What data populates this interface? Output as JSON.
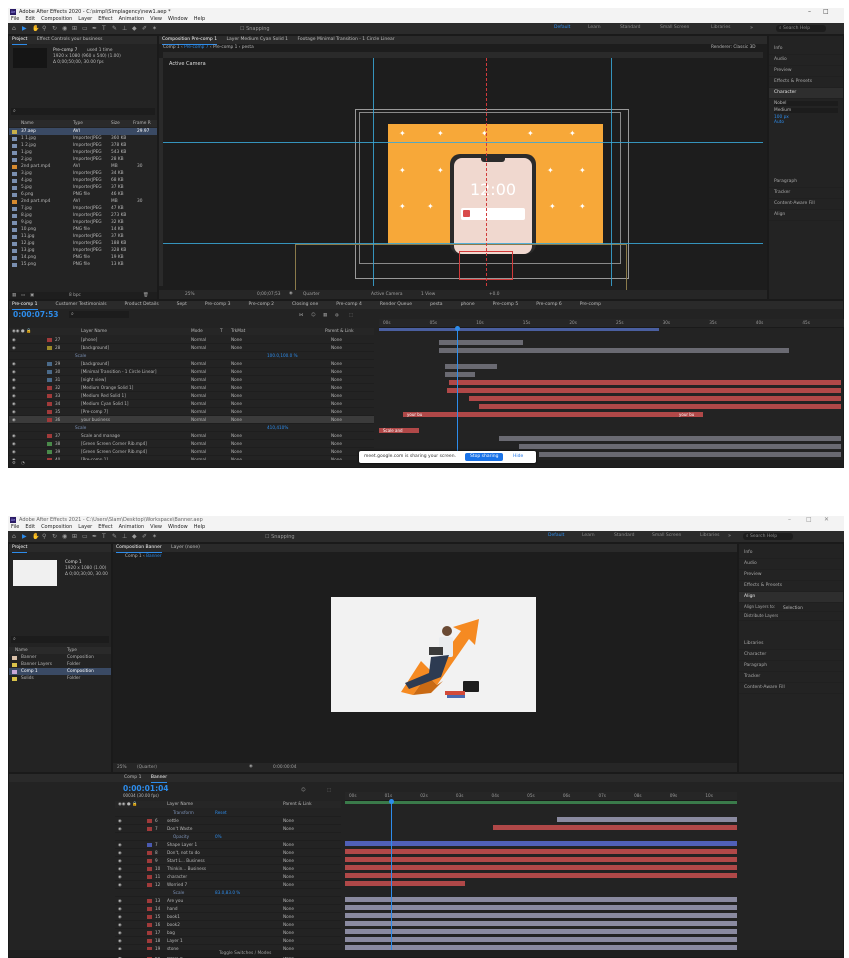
{
  "top": {
    "title": "Adobe After Effects 2020 - C:\\simpl\\Simplagency\\new1.aep *",
    "menu": [
      "File",
      "Edit",
      "Composition",
      "Layer",
      "Effect",
      "Animation",
      "View",
      "Window",
      "Help"
    ],
    "snapping": "Snapping",
    "workspaces": [
      "Default",
      "Learn",
      "Standard",
      "Small Screen",
      "Libraries"
    ],
    "search_placeholder": "Search Help",
    "project_tab": "Project",
    "effect_tab": "Effect Controls your business",
    "precomp_name": "Pre-comp 7",
    "precomp_used": "used 1 time",
    "precomp_info1": "1920 x 1080 (960 x 540) (1.00)",
    "precomp_info2": "Δ 0;00;50;00, 30.00 fps",
    "comp_tabs": [
      "Composition Pre-comp 1",
      "Layer Medium Cyan Solid 1",
      "Footage Minimal Transition - 1 Circle Linear"
    ],
    "viewer_tabs": [
      "Comp 1",
      "Pre-comp 7",
      "Pre-comp 1",
      "pesta"
    ],
    "renderer": "Renderer: Classic 3D",
    "active_camera": "Active Camera",
    "phone_time": "12:00",
    "viewer_bottom": {
      "zoom": "25%",
      "time": "0;00;07;53",
      "res": "Quarter",
      "camera": "Active Camera",
      "view": "1 View",
      "plus": "+0.0"
    },
    "project_columns": [
      "Name",
      "Type",
      "Size",
      "Frame R"
    ],
    "files": [
      {
        "name": "37.aep",
        "type": "AVI",
        "size": "",
        "fr": "29.97",
        "color": "#c8b04a"
      },
      {
        "name": "1 1.jpg",
        "type": "ImporterJPEG",
        "size": "360 KB",
        "fr": "",
        "color": "#7a8fb0"
      },
      {
        "name": "1 2.jpg",
        "type": "ImporterJPEG",
        "size": "378 KB",
        "fr": "",
        "color": "#7a8fb0"
      },
      {
        "name": "1.jpg",
        "type": "ImporterJPEG",
        "size": "543 KB",
        "fr": "",
        "color": "#7a8fb0"
      },
      {
        "name": "2.jpg",
        "type": "ImporterJPEG",
        "size": "28 KB",
        "fr": "",
        "color": "#7a8fb0"
      },
      {
        "name": "2nd part.mp4",
        "type": "AVI",
        "size": "MB",
        "fr": "30",
        "color": "#d68a2f"
      },
      {
        "name": "3.jpg",
        "type": "ImporterJPEG",
        "size": "34 KB",
        "fr": "",
        "color": "#7a8fb0"
      },
      {
        "name": "4.jpg",
        "type": "ImporterJPEG",
        "size": "68 KB",
        "fr": "",
        "color": "#7a8fb0"
      },
      {
        "name": "5.jpg",
        "type": "ImporterJPEG",
        "size": "37 KB",
        "fr": "",
        "color": "#7a8fb0"
      },
      {
        "name": "6.png",
        "type": "PNG file",
        "size": "46 KB",
        "fr": "",
        "color": "#7a8fb0"
      },
      {
        "name": "2nd part.mp4",
        "type": "AVI",
        "size": "MB",
        "fr": "30",
        "color": "#d68a2f"
      },
      {
        "name": "7.jpg",
        "type": "ImporterJPEG",
        "size": "47 KB",
        "fr": "",
        "color": "#7a8fb0"
      },
      {
        "name": "8.jpg",
        "type": "ImporterJPEG",
        "size": "273 KB",
        "fr": "",
        "color": "#7a8fb0"
      },
      {
        "name": "9.jpg",
        "type": "ImporterJPEG",
        "size": "32 KB",
        "fr": "",
        "color": "#7a8fb0"
      },
      {
        "name": "10.png",
        "type": "PNG file",
        "size": "14 KB",
        "fr": "",
        "color": "#7a8fb0"
      },
      {
        "name": "11.jpg",
        "type": "ImporterJPEG",
        "size": "37 KB",
        "fr": "",
        "color": "#7a8fb0"
      },
      {
        "name": "12.jpg",
        "type": "ImporterJPEG",
        "size": "188 KB",
        "fr": "",
        "color": "#7a8fb0"
      },
      {
        "name": "13.jpg",
        "type": "ImporterJPEG",
        "size": "328 KB",
        "fr": "",
        "color": "#7a8fb0"
      },
      {
        "name": "14.png",
        "type": "PNG file",
        "size": "19 KB",
        "fr": "",
        "color": "#7a8fb0"
      },
      {
        "name": "15.png",
        "type": "PNG file",
        "size": "13 KB",
        "fr": "",
        "color": "#7a8fb0"
      }
    ],
    "project_bpc": "8 bpc",
    "right_items": [
      "Info",
      "Audio",
      "Preview",
      "Effects & Presets",
      "Character",
      "Paragraph",
      "Tracker",
      "Content-Aware Fill",
      "Align"
    ],
    "char_font": "Nobel",
    "char_style": "Medium",
    "char_size": "100 px",
    "char_leading": "Auto",
    "timeline_tabs": [
      "Pre-comp 1",
      "Customer Testimonials",
      "Product Details",
      "Sept",
      "Pre-comp 3",
      "Pre-comp 2",
      "Closing one",
      "Pre-comp 4",
      "Render Queue",
      "pesta",
      "phone",
      "Pre-comp 5",
      "Pre-comp 6",
      "Pre-comp"
    ],
    "timecode": "0:00:07:53",
    "layer_columns": [
      "Layer Name",
      "Mode",
      "T",
      "TrkMat",
      "Parent & Link"
    ],
    "ruler_ticks": [
      "00s",
      "05s",
      "10s",
      "15s",
      "20s",
      "25s",
      "30s",
      "35s",
      "40s",
      "45s"
    ],
    "layers": [
      {
        "num": "27",
        "name": "[phone]",
        "mode": "Normal",
        "trk": "None",
        "parent": "None",
        "color": "#a03a3a",
        "sub": false
      },
      {
        "num": "28",
        "name": "[background]",
        "mode": "Normal",
        "trk": "None",
        "parent": "None",
        "color": "#9c8a2a",
        "sub": false
      },
      {
        "num": "",
        "name": "Scale",
        "mode": "",
        "trk": "",
        "parent": "100.0,100.0 %",
        "color": "",
        "sub": true
      },
      {
        "num": "29",
        "name": "[background]",
        "mode": "Normal",
        "trk": "None",
        "parent": "None",
        "color": "#4a6a8a",
        "sub": false
      },
      {
        "num": "30",
        "name": "[Minimal Transition - 1 Circle Linear]",
        "mode": "Normal",
        "trk": "None",
        "parent": "None",
        "color": "#4a6a8a",
        "sub": false
      },
      {
        "num": "31",
        "name": "[night view]",
        "mode": "Normal",
        "trk": "None",
        "parent": "None",
        "color": "#4a6a8a",
        "sub": false
      },
      {
        "num": "32",
        "name": "[Medium Orange Solid 1]",
        "mode": "Normal",
        "trk": "None",
        "parent": "None",
        "color": "#a03a3a",
        "sub": false
      },
      {
        "num": "33",
        "name": "[Medium Red Solid 1]",
        "mode": "Normal",
        "trk": "None",
        "parent": "None",
        "color": "#a03a3a",
        "sub": false
      },
      {
        "num": "34",
        "name": "[Medium Cyan Solid 1]",
        "mode": "Normal",
        "trk": "None",
        "parent": "None",
        "color": "#a03a3a",
        "sub": false
      },
      {
        "num": "35",
        "name": "[Pre-comp 7]",
        "mode": "Normal",
        "trk": "None",
        "parent": "None",
        "color": "#a03a3a",
        "sub": false
      },
      {
        "num": "36",
        "name": "your business",
        "mode": "Normal",
        "trk": "None",
        "parent": "None",
        "color": "#a03a3a",
        "sub": false
      },
      {
        "num": "",
        "name": "Scale",
        "mode": "",
        "trk": "",
        "parent": "410,410%",
        "color": "",
        "sub": true
      },
      {
        "num": "37",
        "name": "Scale and manage",
        "mode": "Normal",
        "trk": "None",
        "parent": "None",
        "color": "#a03a3a",
        "sub": false
      },
      {
        "num": "38",
        "name": "[Green Screen Corner Rib.mp4]",
        "mode": "Normal",
        "trk": "None",
        "parent": "None",
        "color": "#4a8a4a",
        "sub": false
      },
      {
        "num": "39",
        "name": "[Green Screen Corner Rib.mp4]",
        "mode": "Normal",
        "trk": "None",
        "parent": "None",
        "color": "#4a8a4a",
        "sub": false
      },
      {
        "num": "40",
        "name": "[Pre-comp 1]",
        "mode": "Normal",
        "trk": "None",
        "parent": "None",
        "color": "#a03a3a",
        "sub": false
      }
    ],
    "bar_label_1": "your bu",
    "bar_label_2": "your bu",
    "bar_label_3": "Scale and",
    "share_text": "meet.google.com is sharing your screen.",
    "share_stop": "Stop sharing",
    "share_hide": "Hide"
  },
  "bottom": {
    "title": "Adobe After Effects 2021 - C:\\Users\\Slam\\Desktop\\Workspace\\Banner.aep",
    "menu": [
      "File",
      "Edit",
      "Composition",
      "Layer",
      "Effect",
      "Animation",
      "View",
      "Window",
      "Help"
    ],
    "snapping": "Snapping",
    "workspaces": [
      "Default",
      "Learn",
      "Standard",
      "Small Screen",
      "Libraries"
    ],
    "search_placeholder": "Search Help",
    "project_tab": "Project",
    "comp_name": "Comp 1",
    "comp_info1": "1920 x 1080 (1.00)",
    "comp_info2": "Δ 0;00;30;00, 30.00",
    "project_columns": [
      "Name",
      "Type"
    ],
    "files": [
      {
        "name": "Banner",
        "type": "Composition",
        "color": "#d9c0a8"
      },
      {
        "name": "Banner Layers",
        "type": "Folder",
        "color": "#d9c24a"
      },
      {
        "name": "Comp 1",
        "type": "Composition",
        "color": "#c8a8d8"
      },
      {
        "name": "Solids",
        "type": "Folder",
        "color": "#d9c24a"
      }
    ],
    "comp_tab": "Composition Banner",
    "layer_tab": "Layer (none)",
    "viewer_tabs": [
      "Comp 1",
      "Banner"
    ],
    "viewer_bottom": {
      "zoom": "25%",
      "res": "(Quarter)",
      "time": "0:00:00:04"
    },
    "right_items": [
      "Info",
      "Audio",
      "Preview",
      "Effects & Presets",
      "Align",
      "Align Layers to:",
      "Distribute Layers",
      "Libraries",
      "Character",
      "Paragraph",
      "Tracker",
      "Content-Aware Fill"
    ],
    "align_target": "Selection",
    "timeline_tabs": [
      "Comp 1",
      "Banner"
    ],
    "timecode": "0:00:01:04",
    "timecode_sub": "00034 (30.00 fps)",
    "layer_columns": [
      "Layer Name",
      "Parent & Link"
    ],
    "ruler_ticks": [
      "00s",
      "01s",
      "02s",
      "03s",
      "04s",
      "05s",
      "06s",
      "07s",
      "08s",
      "09s",
      "10s"
    ],
    "layers": [
      {
        "num": "",
        "name": "Transform",
        "parent": "Reset",
        "color": "",
        "sub": true
      },
      {
        "num": "6",
        "name": "settle",
        "parent": "None",
        "color": "#a03a3a",
        "sub": false
      },
      {
        "num": "7",
        "name": "Don't Waste",
        "parent": "None",
        "color": "#a03a3a",
        "sub": false
      },
      {
        "num": "",
        "name": "Opacity",
        "parent": "0%",
        "color": "",
        "sub": true
      },
      {
        "num": "7",
        "name": "Shape Layer 1",
        "parent": "None",
        "color": "#4a5ab0",
        "sub": false
      },
      {
        "num": "8",
        "name": "Don't, not to do",
        "parent": "None",
        "color": "#a03a3a",
        "sub": false
      },
      {
        "num": "9",
        "name": "Start L... Business",
        "parent": "None",
        "color": "#a03a3a",
        "sub": false
      },
      {
        "num": "10",
        "name": "Thinkin... Business",
        "parent": "None",
        "color": "#a03a3a",
        "sub": false
      },
      {
        "num": "11",
        "name": "character",
        "parent": "None",
        "color": "#a03a3a",
        "sub": false
      },
      {
        "num": "12",
        "name": "Worried 7",
        "parent": "None",
        "color": "#a03a3a",
        "sub": false
      },
      {
        "num": "",
        "name": "Scale",
        "parent": "83.0,83.0 %",
        "color": "",
        "sub": true
      },
      {
        "num": "13",
        "name": "Are you",
        "parent": "None",
        "color": "#a03a3a",
        "sub": false
      },
      {
        "num": "14",
        "name": "hand",
        "parent": "None",
        "color": "#a03a3a",
        "sub": false
      },
      {
        "num": "15",
        "name": "book1",
        "parent": "None",
        "color": "#a03a3a",
        "sub": false
      },
      {
        "num": "16",
        "name": "book2",
        "parent": "None",
        "color": "#a03a3a",
        "sub": false
      },
      {
        "num": "17",
        "name": "bag",
        "parent": "None",
        "color": "#a03a3a",
        "sub": false
      },
      {
        "num": "18",
        "name": "Layer 1",
        "parent": "None",
        "color": "#a03a3a",
        "sub": false
      },
      {
        "num": "19",
        "name": "stone",
        "parent": "None",
        "color": "#a03a3a",
        "sub": false
      },
      {
        "num": "20",
        "name": "Layer 8",
        "parent": "None",
        "color": "#a03a3a",
        "sub": false
      }
    ],
    "footer": "Toggle Switches / Modes"
  },
  "colors": {
    "accent": "#2d8ceb",
    "orange": "#f7a839",
    "grid": "#3aa8d8",
    "bar_red": "#b04848",
    "bar_grey": "#6a6a72",
    "bar_lavender": "#8a8aa0",
    "bar_blue": "#5060b8"
  }
}
